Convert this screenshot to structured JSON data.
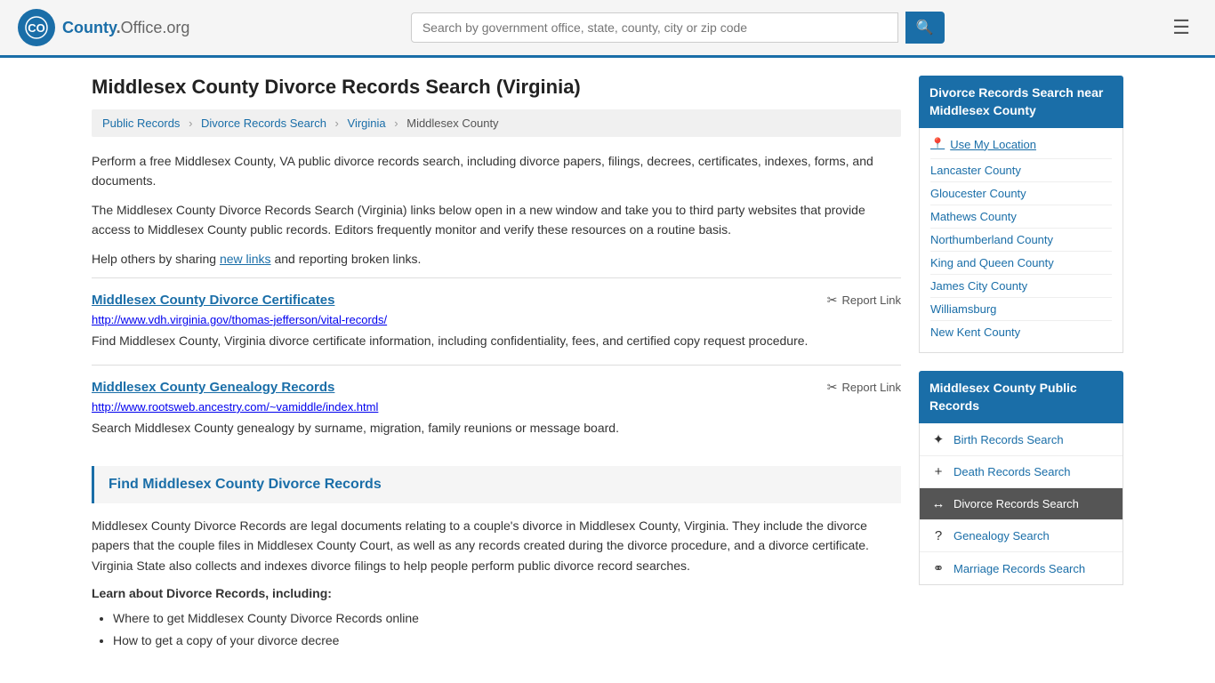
{
  "header": {
    "logo_text": "County",
    "logo_org": "Office.org",
    "search_placeholder": "Search by government office, state, county, city or zip code",
    "search_icon": "🔍",
    "menu_icon": "☰"
  },
  "page": {
    "title": "Middlesex County Divorce Records Search (Virginia)",
    "description1": "Perform a free Middlesex County, VA public divorce records search, including divorce papers, filings, decrees, certificates, indexes, forms, and documents.",
    "description2": "The Middlesex County Divorce Records Search (Virginia) links below open in a new window and take you to third party websites that provide access to Middlesex County public records. Editors frequently monitor and verify these resources on a routine basis.",
    "description3_pre": "Help others by sharing ",
    "description3_link": "new links",
    "description3_post": " and reporting broken links."
  },
  "breadcrumb": {
    "items": [
      "Public Records",
      "Divorce Records Search",
      "Virginia",
      "Middlesex County"
    ],
    "separators": [
      ">",
      ">",
      ">"
    ]
  },
  "records": [
    {
      "title": "Middlesex County Divorce Certificates",
      "url": "http://www.vdh.virginia.gov/thomas-jefferson/vital-records/",
      "description": "Find Middlesex County, Virginia divorce certificate information, including confidentiality, fees, and certified copy request procedure.",
      "report_label": "Report Link"
    },
    {
      "title": "Middlesex County Genealogy Records",
      "url": "http://www.rootsweb.ancestry.com/~vamiddle/index.html",
      "description": "Search Middlesex County genealogy by surname, migration, family reunions or message board.",
      "report_label": "Report Link"
    }
  ],
  "find_section": {
    "title": "Find Middlesex County Divorce Records",
    "info_text": "Middlesex County Divorce Records are legal documents relating to a couple's divorce in Middlesex County, Virginia. They include the divorce papers that the couple files in Middlesex County Court, as well as any records created during the divorce procedure, and a divorce certificate. Virginia State also collects and indexes divorce filings to help people perform public divorce record searches.",
    "learn_title": "Learn about Divorce Records, including:",
    "bullets": [
      "Where to get Middlesex County Divorce Records online",
      "How to get a copy of your divorce decree"
    ]
  },
  "sidebar": {
    "nearby_header": "Divorce Records Search near Middlesex County",
    "use_location": "Use My Location",
    "nearby_links": [
      "Lancaster County",
      "Gloucester County",
      "Mathews County",
      "Northumberland County",
      "King and Queen County",
      "James City County",
      "Williamsburg",
      "New Kent County"
    ],
    "public_records_header": "Middlesex County Public Records",
    "public_records": [
      {
        "icon": "✦",
        "label": "Birth Records Search",
        "active": false
      },
      {
        "icon": "+",
        "label": "Death Records Search",
        "active": false
      },
      {
        "icon": "↔",
        "label": "Divorce Records Search",
        "active": true
      },
      {
        "icon": "?",
        "label": "Genealogy Search",
        "active": false
      },
      {
        "icon": "⚭",
        "label": "Marriage Records Search",
        "active": false
      }
    ]
  }
}
